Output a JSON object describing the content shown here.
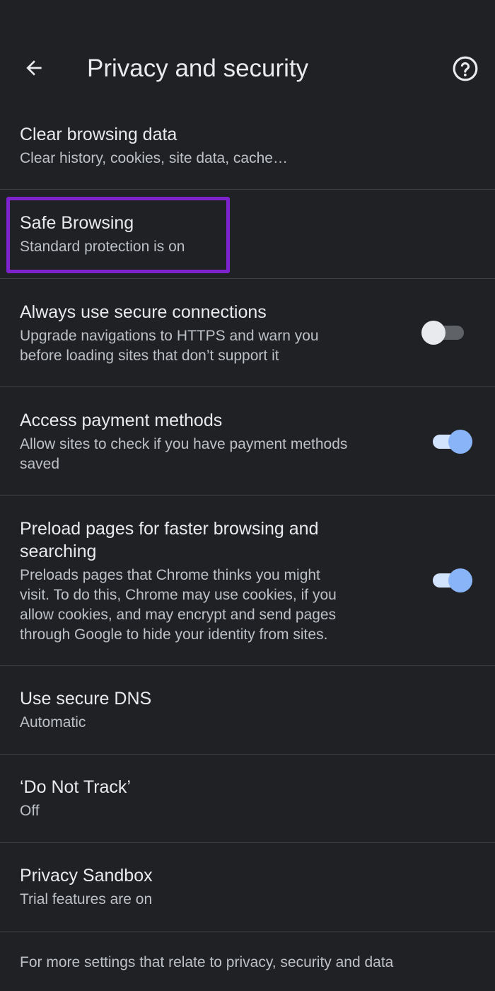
{
  "header": {
    "title": "Privacy and security",
    "back_icon": "arrow-left-icon",
    "help_icon": "help-circle-icon"
  },
  "settings": [
    {
      "title": "Clear browsing data",
      "summary": [
        "Clear history, cookies, site data, cache…"
      ]
    },
    {
      "title": "Safe Browsing",
      "summary": [
        "Standard protection is on"
      ]
    },
    {
      "title": "Always use secure connections",
      "summary": [
        "Upgrade navigations to HTTPS and warn you",
        "before loading sites that don’t support it"
      ],
      "toggle": false
    },
    {
      "title": "Access payment methods",
      "summary": [
        "Allow sites to check if you have payment methods",
        "saved"
      ],
      "toggle": true
    },
    {
      "title": [
        "Preload pages for faster browsing and",
        "searching"
      ],
      "summary": [
        "Preloads pages that Chrome thinks you might",
        "visit. To do this, Chrome may use cookies, if you",
        "allow cookies, and may encrypt and send pages",
        "through Google to hide your identity from sites."
      ],
      "toggle": true
    },
    {
      "title": "Use secure DNS",
      "summary": [
        "Automatic"
      ]
    },
    {
      "title": "‘Do Not Track’",
      "summary": [
        "Off"
      ]
    },
    {
      "title": "Privacy Sandbox",
      "summary": [
        "Trial features are on"
      ]
    }
  ],
  "footer": {
    "text": "For more settings that relate to privacy, security and data"
  },
  "colors": {
    "background": "#202124",
    "highlight": "#7e22ce",
    "toggle_on": "#8ab4f8"
  }
}
